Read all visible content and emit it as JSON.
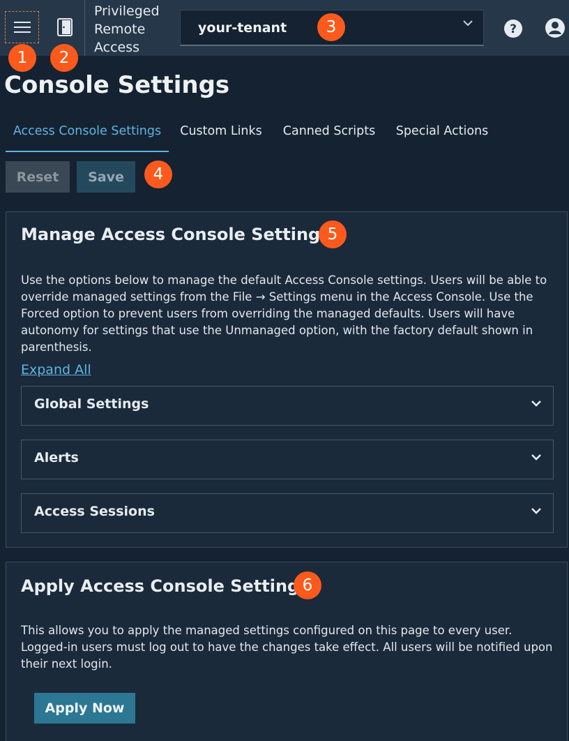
{
  "topbar": {
    "app_title": "Privileged Remote Access",
    "tenant_value": "your-tenant",
    "icons": {
      "menu": "hamburger-menu-icon",
      "console": "access-console-icon",
      "help": "help-icon",
      "user": "user-account-icon",
      "dropdown": "chevron-down-icon"
    }
  },
  "callouts": [
    "1",
    "2",
    "3",
    "4",
    "5",
    "6"
  ],
  "page": {
    "title": "Console Settings",
    "tabs": [
      {
        "label": "Access Console Settings",
        "active": true
      },
      {
        "label": "Custom Links",
        "active": false
      },
      {
        "label": "Canned Scripts",
        "active": false
      },
      {
        "label": "Special Actions",
        "active": false
      }
    ]
  },
  "actions": {
    "reset_label": "Reset",
    "save_label": "Save"
  },
  "manage": {
    "title": "Manage Access Console Settings",
    "description": "Use the options below to manage the default Access Console settings. Users will be able to override managed settings from the File → Settings menu in the Access Console. Use the Forced option to prevent users from overriding the managed defaults. Users will have autonomy for settings that use the Unmanaged option, with the factory default shown in parenthesis.",
    "expand_all": "Expand All",
    "sections": [
      {
        "label": "Global Settings"
      },
      {
        "label": "Alerts"
      },
      {
        "label": "Access Sessions"
      }
    ]
  },
  "apply": {
    "title": "Apply Access Console Settings",
    "description": "This allows you to apply the managed settings configured on this page to every user. Logged-in users must log out to have the changes take effect. All users will be notified upon their next login.",
    "button_label": "Apply Now"
  },
  "colors": {
    "background": "#152231",
    "topbar": "#26374a",
    "accent": "#5fb5e0",
    "callout": "#fc5a1d",
    "apply_button": "#2c7793"
  }
}
